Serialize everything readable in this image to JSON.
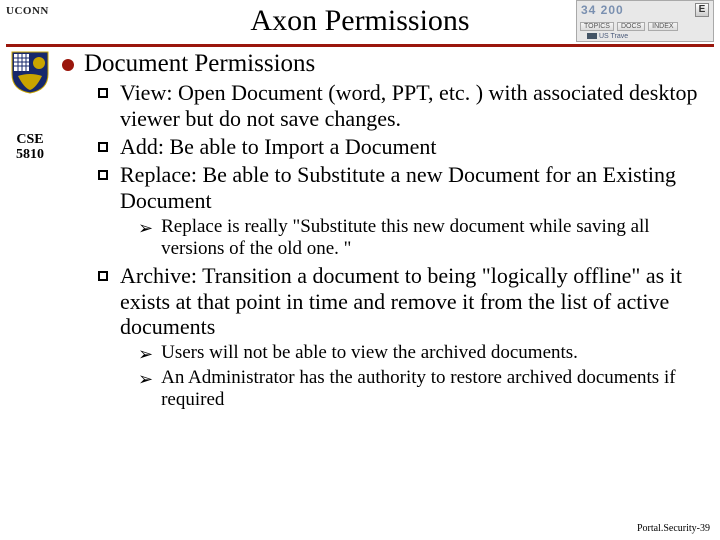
{
  "header": {
    "title": "Axon Permissions",
    "uconn_label": "UCONN"
  },
  "topright": {
    "numbers": "34   200",
    "close": "E",
    "tabs": [
      "TOPICS",
      "DOCS",
      "INDEX"
    ],
    "country": "US  Trave"
  },
  "sidebar": {
    "course_line1": "CSE",
    "course_line2": "5810"
  },
  "content": {
    "l1": "Document Permissions",
    "items": [
      "View: Open Document (word, PPT, etc. ) with associated desktop viewer but do not save changes.",
      "Add: Be able to Import a Document",
      "Replace: Be able to Substitute a new Document for an Existing Document"
    ],
    "note1": "Replace is really \"Substitute this new document while saving all versions of the old one. \"",
    "item4": "Archive: Transition a document to being \"logically offline\" as it exists at that point in time and remove it from the list of active documents",
    "note2a": "Users will not be able to view the archived documents.",
    "note2b": "An Administrator has the authority to restore archived documents if required"
  },
  "footer": "Portal.Security-39"
}
